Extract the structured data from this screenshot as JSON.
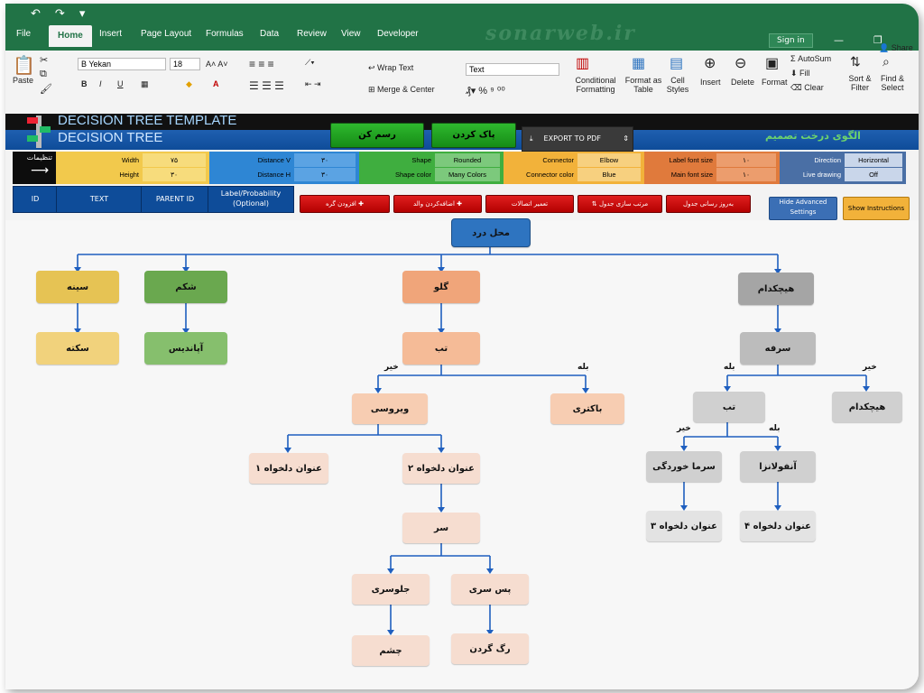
{
  "ribbon_tabs": [
    "File",
    "Home",
    "Insert",
    "Page Layout",
    "Formulas",
    "Data",
    "Review",
    "View",
    "Developer"
  ],
  "watermark": "sonarweb.ir",
  "signin": "Sign in",
  "share": "Share",
  "clipboard": {
    "paste": "Paste"
  },
  "font": {
    "name": "B Yekan",
    "size": "18"
  },
  "alignment": {
    "wrap_text": "Wrap Text",
    "merge_center": "Merge & Center"
  },
  "number": {
    "format": "Text"
  },
  "styles": {
    "conditional": "Conditional Formatting",
    "format_table": "Format as Table",
    "cell_styles": "Cell Styles"
  },
  "cells": {
    "insert": "Insert",
    "delete": "Delete",
    "format": "Format"
  },
  "editing": {
    "autosum": "AutoSum",
    "fill": "Fill",
    "clear": "Clear",
    "sort_filter": "Sort & Filter",
    "find_select": "Find & Select"
  },
  "header": {
    "title_en_1": "DECISION TREE TEMPLATE",
    "title_en_2": "DECISION TREE",
    "title_fa_1": "الگوی درخت تصمیم",
    "title_fa_2": "درخت تصمیم",
    "draw_button": "رسم کن",
    "clear_button": "پاک کردن",
    "export_button": "EXPORT TO PDF"
  },
  "settings": {
    "label": "تنظیمات",
    "width_label": "Width",
    "width_value": "۷۵",
    "height_label": "Height",
    "height_value": "۳۰",
    "distv_label": "Distance V",
    "distv_value": "۳۰",
    "disth_label": "Distance H",
    "disth_value": "۳۰",
    "shape_label": "Shape",
    "shape_value": "Rounded",
    "shapecolor_label": "Shape color",
    "shapecolor_value": "Many Colors",
    "connector_label": "Connector",
    "connector_value": "Elbow",
    "connectorcolor_label": "Connector color",
    "connectorcolor_value": "Blue",
    "labelfont_label": "Label font size",
    "labelfont_value": "۱۰",
    "mainfont_label": "Main font size",
    "mainfont_value": "۱۰",
    "direction_label": "Direction",
    "direction_value": "Horizontal",
    "livedraw_label": "Live drawing",
    "livedraw_value": "Off"
  },
  "columns": {
    "id": "ID",
    "text": "TEXT",
    "parent": "PARENT ID",
    "label": "Label/Probability (Optional)"
  },
  "actions": {
    "add_node": "افزودن گره ✚",
    "add_parent": "اضافه‌کردن والد ✚",
    "repair": "تعمیر اتصالات",
    "sort": "⇅ مرتب سازی جدول",
    "update": "به‌روز رسانی جدول",
    "hide_adv": "Hide Advanced Settings",
    "show_instr": "Show Instructions"
  },
  "tree": {
    "root": "محل درد",
    "n_sine": "سینه",
    "n_shekam": "شکم",
    "n_galu": "گلو",
    "n_hichkodam": "هیچکدام",
    "n_sekte": "سکته",
    "n_apandis": "آپاندیس",
    "n_tab1": "تب",
    "n_sorfe": "سرفه",
    "n_virusi": "ویروسی",
    "n_bakteri": "باکتری",
    "n_tab2": "تب",
    "n_hichkodam2": "هیچکدام",
    "n_custom1": "عنوان دلخواه ۱",
    "n_custom2": "عنوان دلخواه ۲",
    "n_sarmakhordegi": "سرما خوردگی",
    "n_anfolanza": "آنفولانزا",
    "n_sar": "سر",
    "n_custom3": "عنوان دلخواه ۳",
    "n_custom4": "عنوان دلخواه ۴",
    "n_jolosari": "جلوسری",
    "n_passari": "پس سری",
    "n_cheshm": "چشم",
    "n_raggardan": "رگ گردن",
    "lbl_kheir1": "خیر",
    "lbl_bale1": "بله",
    "lbl_bale2": "بله",
    "lbl_kheir2": "خیر",
    "lbl_kheir3": "خیر",
    "lbl_bale3": "بله"
  },
  "colors": {
    "yellow": "#e6c354",
    "green": "#6aa84f",
    "orange": "#f0a57a",
    "gray": "#a5a5a5",
    "light_orange": "#f7cdb2",
    "light_gray": "#d0d0d0",
    "peach": "#f6ddd0",
    "connector": "#1f5fbf"
  }
}
